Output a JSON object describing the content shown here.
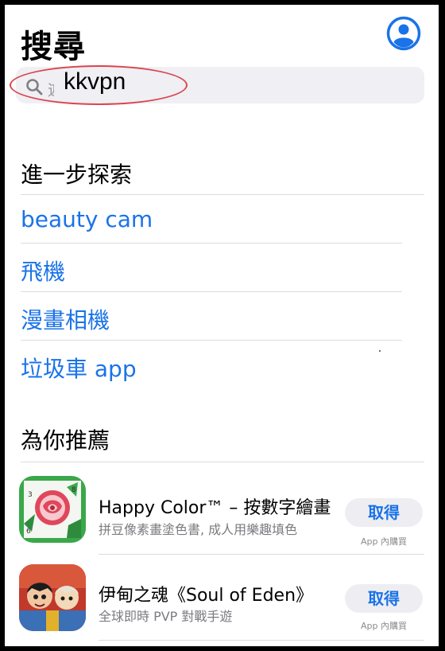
{
  "header": {
    "title": "搜尋",
    "profile_icon": "person-circle-icon"
  },
  "search": {
    "placeholder_fragment": "遊",
    "value": "kkvpn",
    "icon": "magnifier-icon"
  },
  "discover": {
    "title": "進一步探索",
    "items": [
      {
        "label": "beauty cam"
      },
      {
        "label": "飛機"
      },
      {
        "label": "漫畫相機"
      },
      {
        "label": "垃圾車 app"
      }
    ]
  },
  "recommended": {
    "title": "為你推薦",
    "apps": [
      {
        "name": "Happy Color™ – 按數字繪畫",
        "subtitle": "拼豆像素畫塗色書, 成人用樂趣填色",
        "button": "取得",
        "iap": "App 內購買"
      },
      {
        "name": "伊甸之魂《Soul of Eden》",
        "subtitle": "全球即時 PVP 對戰手遊",
        "button": "取得",
        "iap": "App 內購買"
      }
    ]
  },
  "colors": {
    "accent": "#1a73e8",
    "annotation": "#d9464d",
    "search_bg": "#efeff4"
  }
}
